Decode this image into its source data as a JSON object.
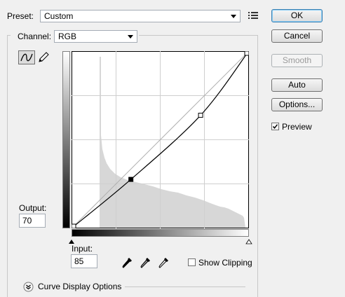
{
  "preset": {
    "label": "Preset:",
    "value": "Custom"
  },
  "channel": {
    "label": "Channel:",
    "value": "RGB"
  },
  "buttons": {
    "ok": "OK",
    "cancel": "Cancel",
    "smooth": "Smooth",
    "auto": "Auto",
    "options": "Options..."
  },
  "preview": {
    "label": "Preview",
    "checked": true
  },
  "output": {
    "label": "Output:",
    "value": "70"
  },
  "input": {
    "label": "Input:",
    "value": "85"
  },
  "show_clipping": {
    "label": "Show Clipping",
    "checked": false
  },
  "curve_display": {
    "label": "Curve Display Options"
  },
  "curve": {
    "points": [
      [
        0,
        0
      ],
      [
        85,
        70
      ],
      [
        186,
        163
      ],
      [
        255,
        255
      ]
    ],
    "selected_point": [
      85,
      70
    ],
    "range": [
      0,
      255
    ],
    "grid_divisions": 4
  },
  "histogram": {
    "values": [
      0,
      0,
      0,
      0,
      0,
      0,
      0,
      0,
      0,
      0,
      0,
      0,
      0,
      0,
      0,
      0,
      0,
      0,
      0,
      0,
      0,
      0,
      0,
      0,
      0,
      0,
      0,
      0,
      0,
      0,
      0,
      0,
      0,
      0,
      0,
      0,
      0,
      0,
      0,
      0,
      0,
      0,
      0,
      0,
      0,
      0,
      0,
      0,
      0,
      0,
      0,
      0,
      0,
      0,
      0,
      0,
      0,
      0,
      0,
      0,
      0,
      0,
      0,
      0,
      0,
      0,
      0,
      0,
      0,
      0,
      0,
      0,
      0,
      0,
      0,
      0,
      0,
      0,
      0,
      0,
      0,
      0,
      0,
      0,
      0,
      0,
      0,
      0,
      0,
      0,
      0,
      0,
      0,
      0,
      0,
      0,
      0,
      0,
      0,
      0,
      0,
      0,
      0,
      0,
      0,
      0,
      0,
      0,
      0,
      0,
      0,
      0,
      0,
      0,
      0,
      0,
      0,
      0,
      0,
      0,
      0,
      0,
      0,
      0,
      0,
      0,
      0,
      0,
      0,
      0,
      0,
      0,
      0,
      0,
      0,
      0,
      0,
      0,
      0,
      0,
      0,
      0,
      0,
      0,
      0,
      0,
      0,
      0,
      0,
      0,
      0,
      0,
      0,
      0,
      0,
      0,
      0,
      0,
      0,
      0,
      0,
      0,
      0,
      0,
      0,
      0,
      0,
      0,
      0,
      0,
      0,
      0,
      0,
      0,
      0,
      0,
      0,
      0,
      0,
      0,
      0,
      0,
      0,
      0,
      0,
      0,
      0,
      0,
      0,
      0,
      0,
      0,
      0,
      0,
      0,
      0,
      0,
      0,
      0,
      0,
      0,
      0,
      0,
      0,
      0,
      0,
      0,
      0,
      0,
      0,
      0,
      0,
      0,
      0,
      0,
      0,
      0,
      0,
      0,
      0,
      0,
      0,
      0,
      0,
      0,
      0,
      0,
      0,
      0,
      0,
      0,
      0,
      0,
      0,
      0,
      0,
      0,
      0,
      0,
      0
    ],
    "color": "#d7d7d7"
  }
}
